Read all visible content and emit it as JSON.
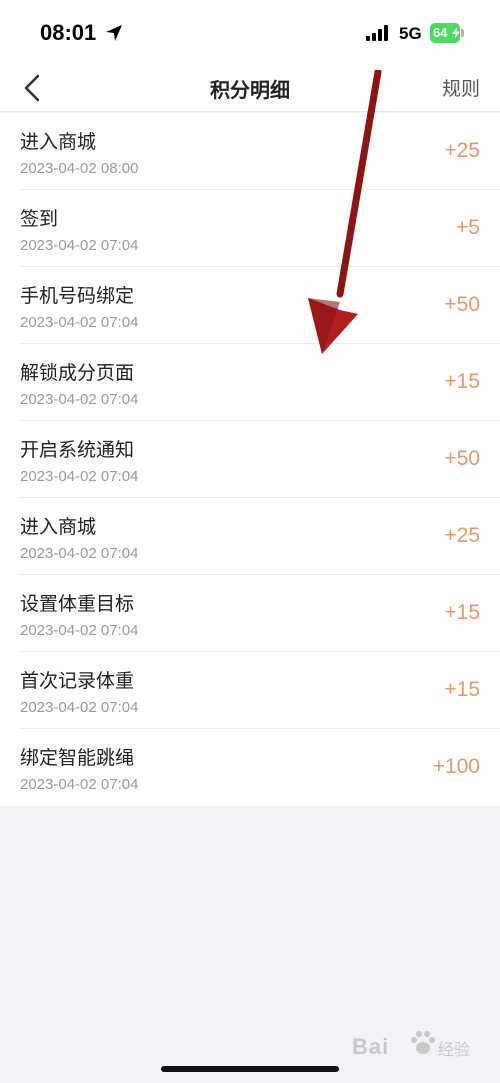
{
  "status": {
    "time": "08:01",
    "network": "5G",
    "battery": "64"
  },
  "nav": {
    "title": "积分明细",
    "rules": "规则"
  },
  "items": [
    {
      "title": "进入商城",
      "time": "2023-04-02 08:00",
      "points": "+25"
    },
    {
      "title": "签到",
      "time": "2023-04-02 07:04",
      "points": "+5"
    },
    {
      "title": "手机号码绑定",
      "time": "2023-04-02 07:04",
      "points": "+50"
    },
    {
      "title": "解锁成分页面",
      "time": "2023-04-02 07:04",
      "points": "+15"
    },
    {
      "title": "开启系统通知",
      "time": "2023-04-02 07:04",
      "points": "+50"
    },
    {
      "title": "进入商城",
      "time": "2023-04-02 07:04",
      "points": "+25"
    },
    {
      "title": "设置体重目标",
      "time": "2023-04-02 07:04",
      "points": "+15"
    },
    {
      "title": "首次记录体重",
      "time": "2023-04-02 07:04",
      "points": "+15"
    },
    {
      "title": "绑定智能跳绳",
      "time": "2023-04-02 07:04",
      "points": "+100"
    }
  ],
  "watermark": {
    "text": "Bai",
    "sub": "经验"
  },
  "colors": {
    "points": "#e8976a",
    "arrow": "#b01e1e",
    "battery": "#4cd964"
  }
}
